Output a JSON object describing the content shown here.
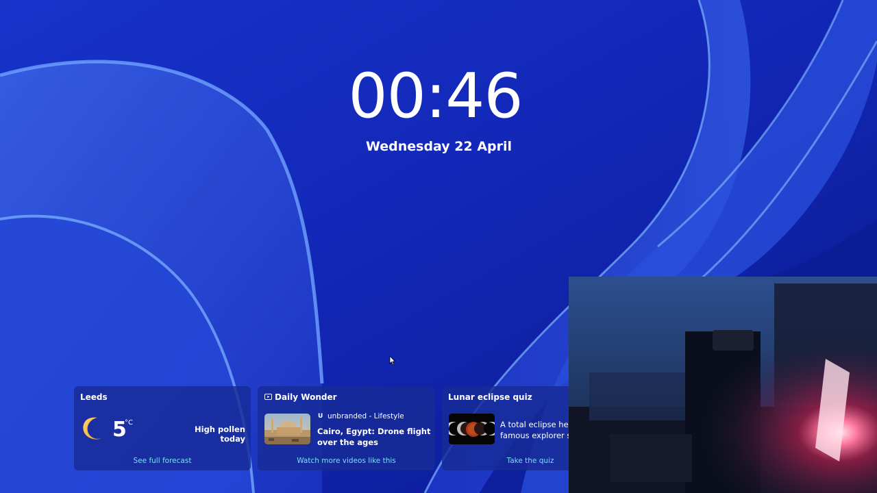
{
  "lock_screen": {
    "time": "00:46",
    "date": "Wednesday 22 April"
  },
  "widgets": {
    "weather": {
      "title": "Leeds",
      "icon": "moon-icon",
      "temperature": "5",
      "unit": "°C",
      "status": "High pollen today",
      "link": "See full forecast"
    },
    "daily_wonder": {
      "title": "Daily Wonder",
      "title_icon": "video-icon",
      "source_logo": "U",
      "source": "unbranded - Lifestyle",
      "headline": "Cairo, Egypt: Drone flight over the ages",
      "link": "Watch more videos like this"
    },
    "quiz": {
      "title": "Lunar eclipse quiz",
      "text_line1": "A total eclipse help",
      "text_line2": "famous explorer su",
      "link": "Take the quiz"
    }
  },
  "colors": {
    "background": "#1628b8",
    "card": "#172b96",
    "link": "#7fdcff"
  }
}
